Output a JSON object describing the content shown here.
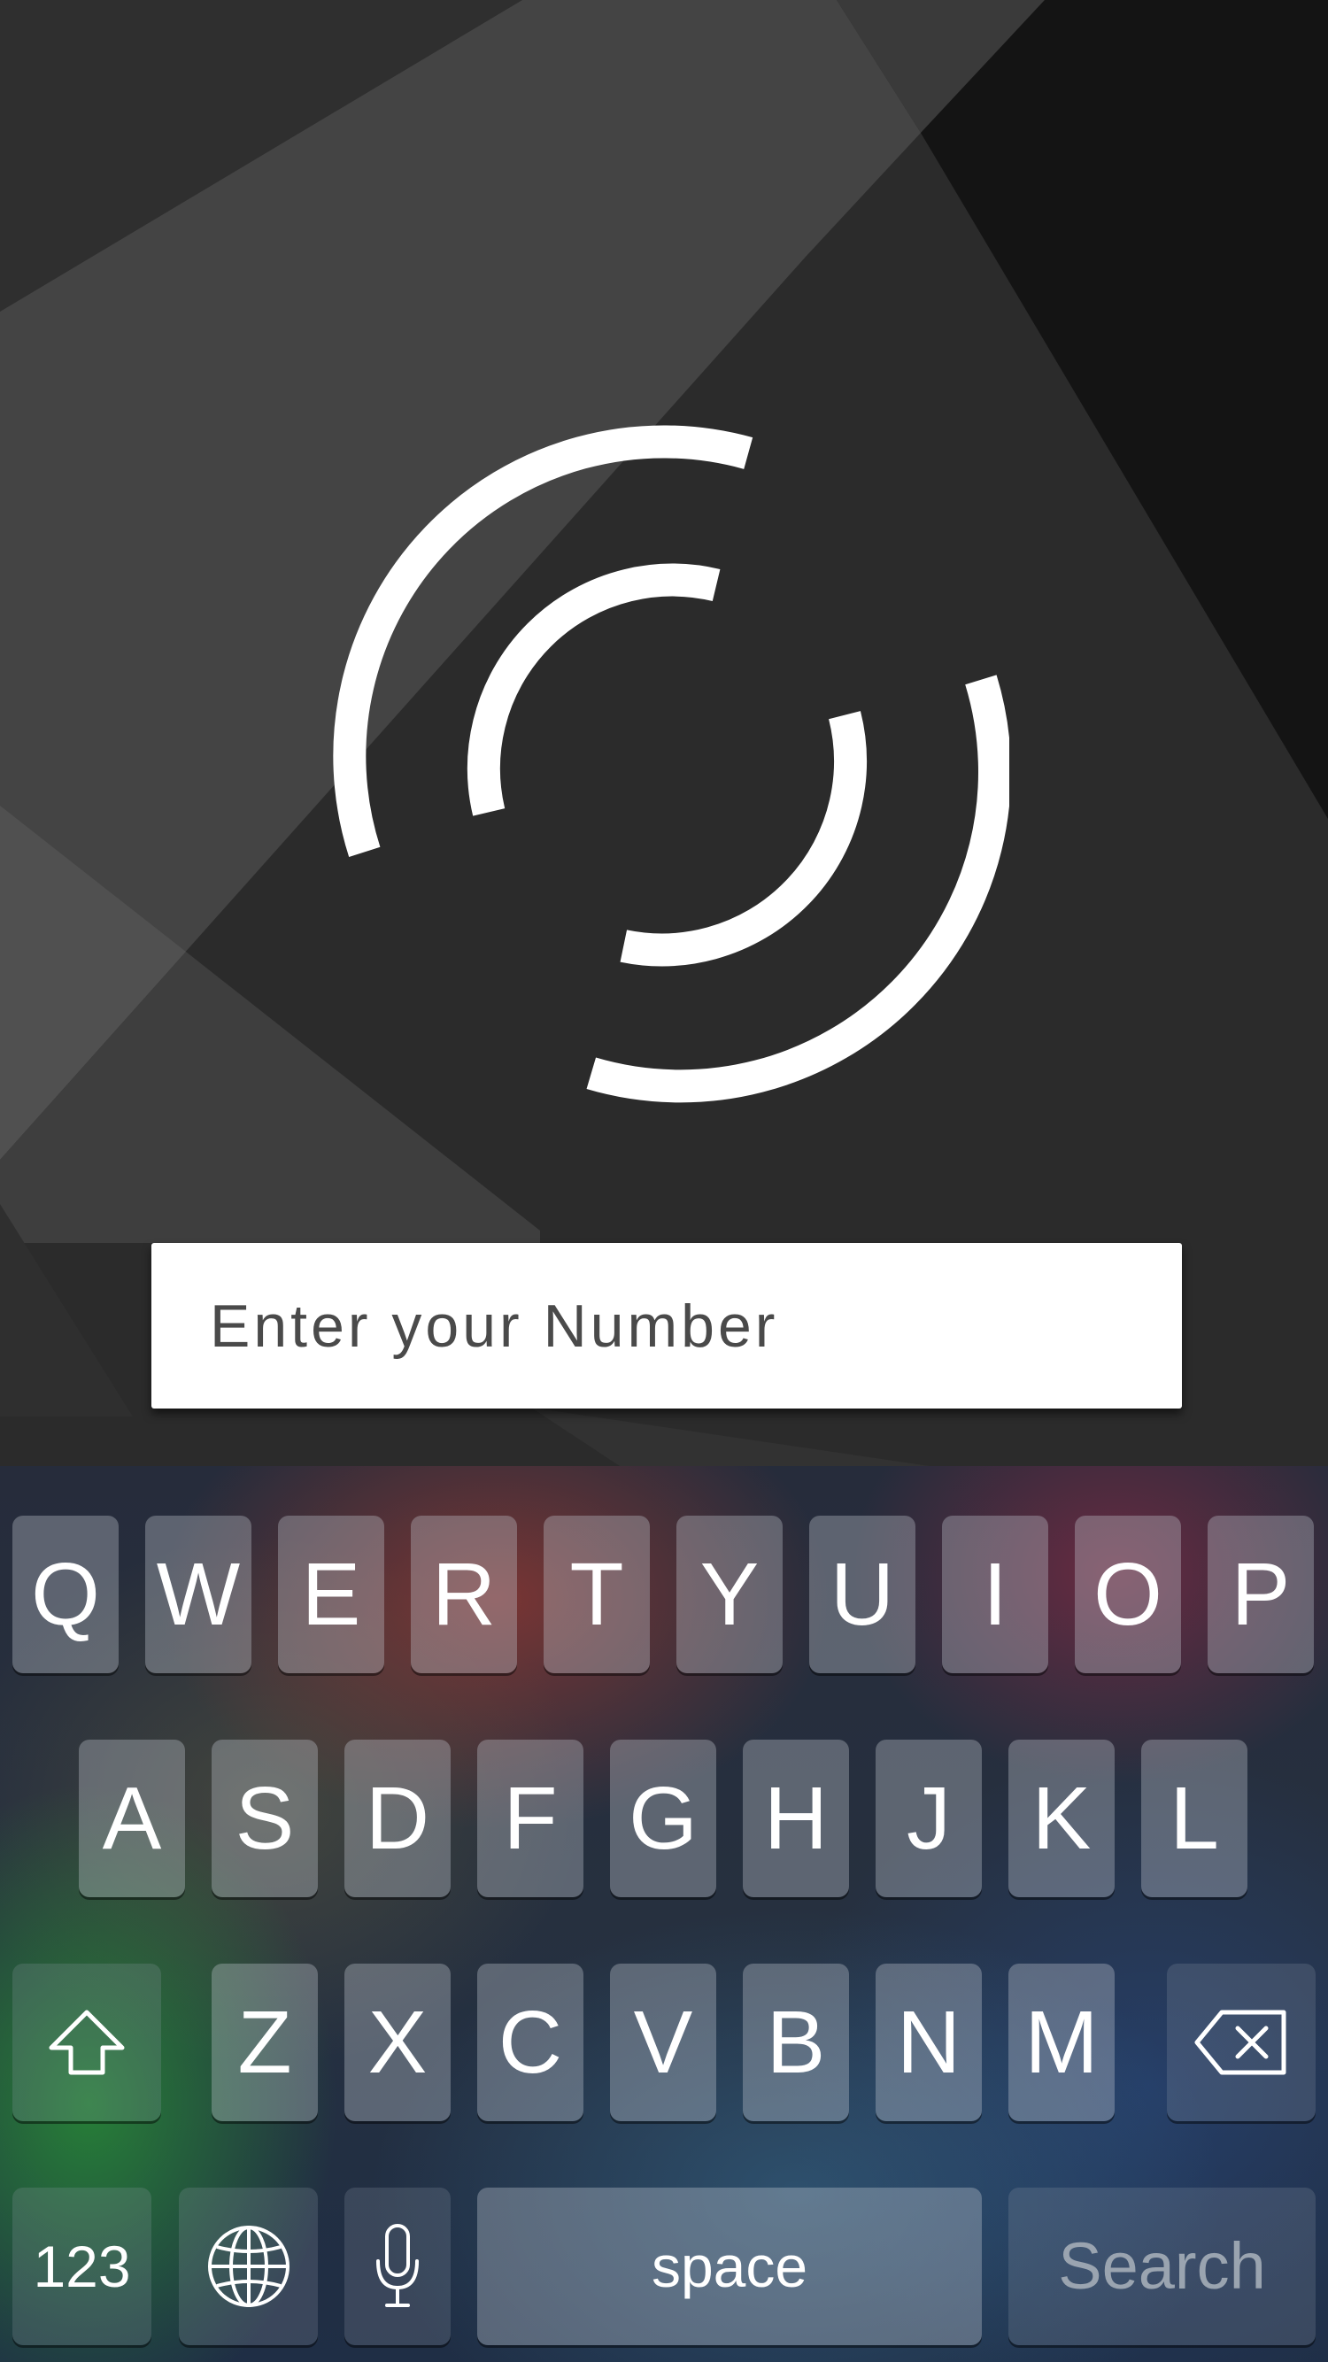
{
  "colors": {
    "background": "#2b2b2b",
    "logo": "#ffffff",
    "field_background": "#ffffff",
    "field_text": "#4a4a4a",
    "key_text": "#ffffff",
    "search_key_text": "#9aa4b0"
  },
  "logo": {
    "icon": "concentric-broken-rings-logo"
  },
  "phone_field": {
    "placeholder": "Enter your Number",
    "value": ""
  },
  "keyboard": {
    "row1": [
      "Q",
      "W",
      "E",
      "R",
      "T",
      "Y",
      "U",
      "I",
      "O",
      "P"
    ],
    "row2": [
      "A",
      "S",
      "D",
      "F",
      "G",
      "H",
      "J",
      "K",
      "L"
    ],
    "row3": [
      "Z",
      "X",
      "C",
      "V",
      "B",
      "N",
      "M"
    ],
    "shift_icon": "shift-arrow-icon",
    "backspace_icon": "backspace-icon",
    "numbers_label": "123",
    "globe_icon": "globe-icon",
    "mic_icon": "microphone-icon",
    "space_label": "space",
    "search_label": "Search"
  }
}
